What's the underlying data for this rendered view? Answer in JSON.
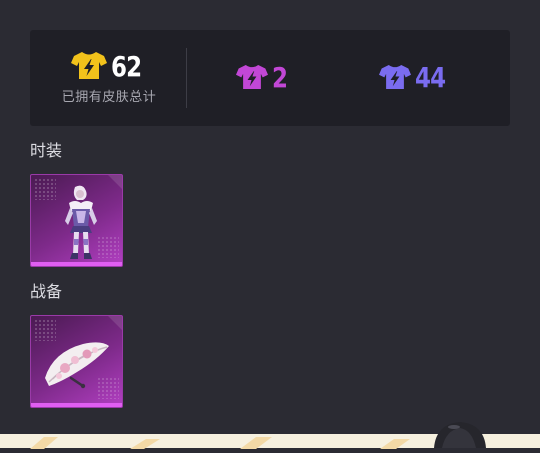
{
  "summary": {
    "total_count": "62",
    "total_caption": "已拥有皮肤总计",
    "epic_count": "2",
    "rare_count": "44"
  },
  "colors": {
    "legendary": "#f2c21b",
    "epic": "#c247d6",
    "rare": "#7a6cf0"
  },
  "icons": {
    "legendary": "tshirt-bolt-icon",
    "epic": "tshirt-bolt-icon",
    "rare": "tshirt-bolt-icon"
  },
  "sections": [
    {
      "title": "时装",
      "items": [
        {
          "icon": "outfit-figure-icon",
          "rarity": "epic"
        }
      ]
    },
    {
      "title": "战备",
      "items": [
        {
          "icon": "glider-icon",
          "rarity": "epic"
        }
      ]
    }
  ]
}
